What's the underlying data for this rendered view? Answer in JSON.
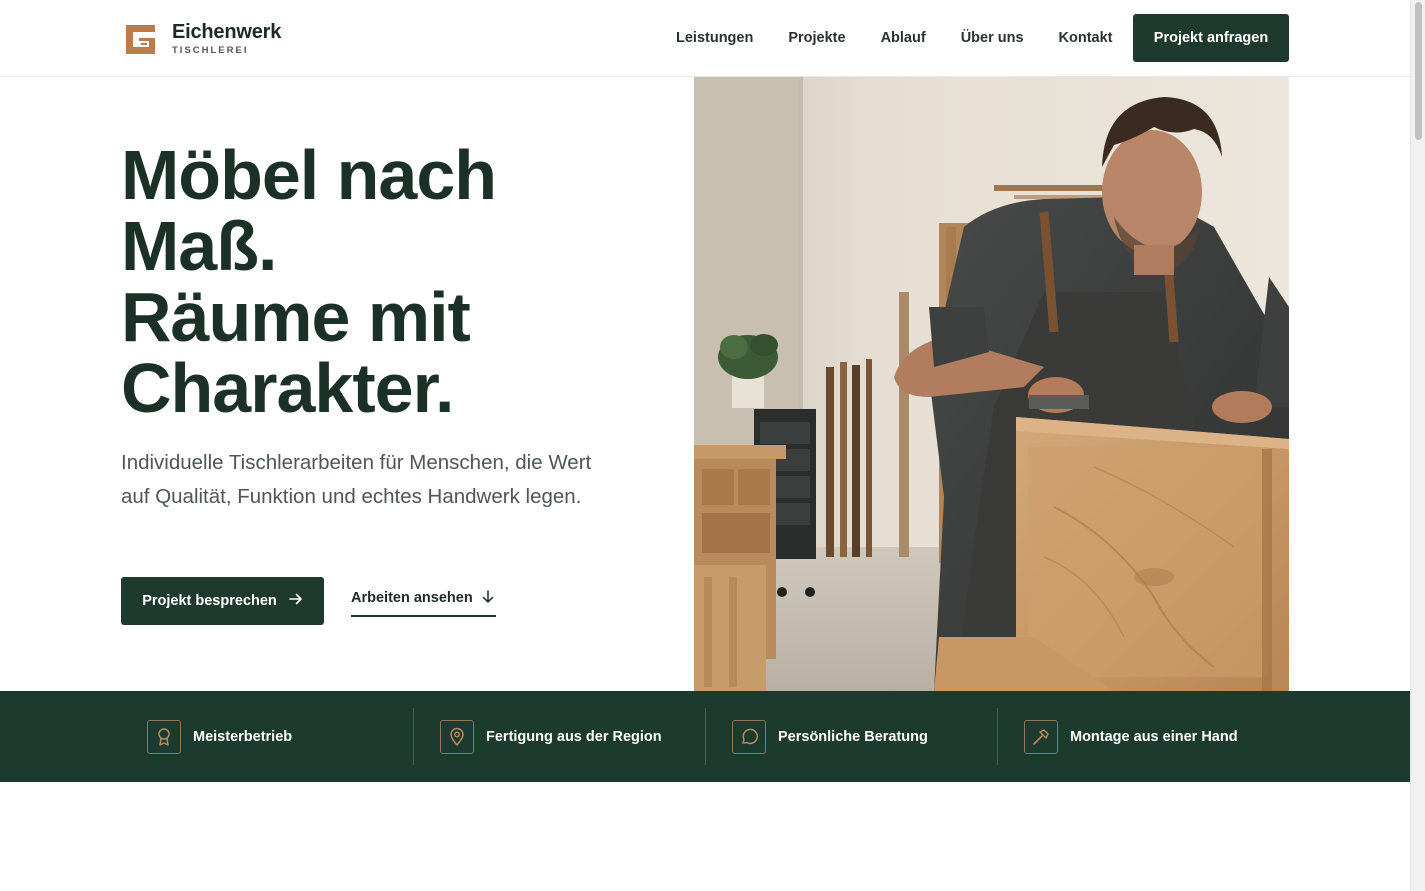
{
  "brand": {
    "name": "Eichenwerk",
    "subtitle": "TISCHLEREI",
    "logo_icon": "square-bracket-logo",
    "accent_color": "#b87c4f",
    "primary_color": "#1e3a2f"
  },
  "nav": {
    "items": [
      "Leistungen",
      "Projekte",
      "Ablauf",
      "Über uns",
      "Kontakt"
    ],
    "cta_label": "Projekt anfragen"
  },
  "hero": {
    "title_lines": [
      "Möbel nach",
      "Maß.",
      "Räume mit",
      "Charakter."
    ],
    "subtitle": "Individuelle Tischlerarbeiten für Menschen, die Wert auf Qualität, Funktion und echtes Handwerk legen.",
    "primary_button": "Projekt besprechen",
    "primary_button_icon": "arrow-right-icon",
    "secondary_link": "Arbeiten ansehen",
    "secondary_link_icon": "arrow-down-icon"
  },
  "features": [
    {
      "label": "Meisterbetrieb",
      "icon": "award-icon"
    },
    {
      "label": "Fertigung aus der Region",
      "icon": "map-pin-icon"
    },
    {
      "label": "Persönliche Beratung",
      "icon": "chat-bubble-icon"
    },
    {
      "label": "Montage aus einer Hand",
      "icon": "hammer-icon"
    }
  ]
}
